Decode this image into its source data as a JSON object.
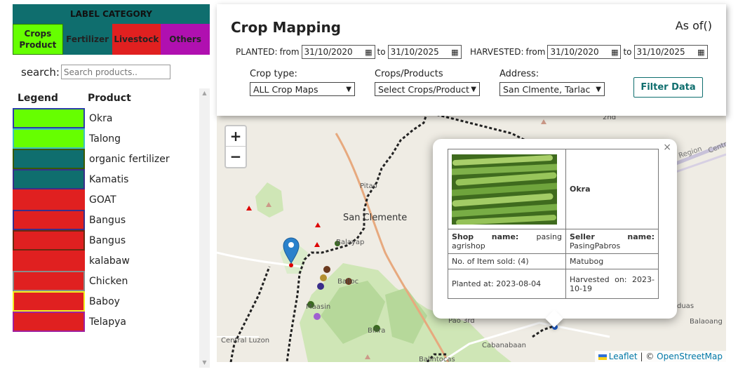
{
  "categories": {
    "header": "LABEL CATEGORY",
    "items": [
      {
        "label": "Crops Product",
        "color": "#66ff00"
      },
      {
        "label": "Fertilizer",
        "color": "#0f6e6e"
      },
      {
        "label": "Livestock",
        "color": "#e02020"
      },
      {
        "label": "Others",
        "color": "#b010b0"
      }
    ]
  },
  "search": {
    "label": "search:",
    "placeholder": "Search products.."
  },
  "legend": {
    "legend_header": "Legend",
    "product_header": "Product",
    "items": [
      {
        "name": "Okra",
        "fill": "#66ff00",
        "border": "#2b3fa8"
      },
      {
        "name": "Talong",
        "fill": "#66ff00",
        "border": "#3ec0c0"
      },
      {
        "name": "organic fertilizer",
        "fill": "#0f6e6e",
        "border": "#3a5a00"
      },
      {
        "name": "Kamatis",
        "fill": "#0f6e6e",
        "border": "#3a2e8a"
      },
      {
        "name": "GOAT",
        "fill": "#e02020",
        "border": "#e02020"
      },
      {
        "name": "Bangus",
        "fill": "#e02020",
        "border": "#3a2e8a"
      },
      {
        "name": "Bangus",
        "fill": "#e02020",
        "border": "#6a2a10"
      },
      {
        "name": "kalabaw",
        "fill": "#e02020",
        "border": "#e02020"
      },
      {
        "name": "Chicken",
        "fill": "#e02020",
        "border": "#8a8a8a"
      },
      {
        "name": "Baboy",
        "fill": "#e02020",
        "border": "#f0f020"
      },
      {
        "name": "Telapya",
        "fill": "#e02020",
        "border": "#a020a0"
      }
    ]
  },
  "filter": {
    "title": "Crop Mapping",
    "as_of": "As of()",
    "planted_label": "PLANTED:",
    "harvested_label": "HARVESTED:",
    "from": "from",
    "to": "to",
    "planted_from": "31/10/2020",
    "planted_to": "31/10/2025",
    "harvested_from": "31/10/2020",
    "harvested_to": "31/10/2025",
    "crop_type_label": "Crop type:",
    "crop_type_value": "ALL Crop Maps",
    "products_label": "Crops/Products",
    "products_value": "Select Crops/Products",
    "address_label": "Address:",
    "address_value": "San Clmente, Tarlac",
    "button": "Filter Data"
  },
  "map": {
    "labels": {
      "san_clemente": "San Clemente",
      "pitao": "Pitao",
      "balayap": "Balayap",
      "balloc": "Balloc",
      "maasin": "Maasin",
      "bilira": "Bilira",
      "pao3rd": "Pao 3rd",
      "cabanabaan": "Cabanabaan",
      "balaoang": "Balaoang",
      "duas": "duas",
      "second": "2nd",
      "region": "Region",
      "central": "Centra",
      "central_luzon": "Central Luzon",
      "balintocas": "Balintocas"
    },
    "zoom_in": "+",
    "zoom_out": "−",
    "attribution": {
      "leaflet": "Leaflet",
      "sep": "|",
      "copy": "©",
      "osm": "OpenStreetMap"
    }
  },
  "popup": {
    "close": "×",
    "product": "Okra",
    "shop_label": "Shop name:",
    "shop_value": "pasing agrishop",
    "seller_label": "Seller name:",
    "seller_value": "PasingPabros",
    "sold": "No. of Item sold: (4)",
    "location": "Matubog",
    "planted": "Planted at: 2023-08-04",
    "harvested": "Harvested on: 2023-10-19"
  }
}
